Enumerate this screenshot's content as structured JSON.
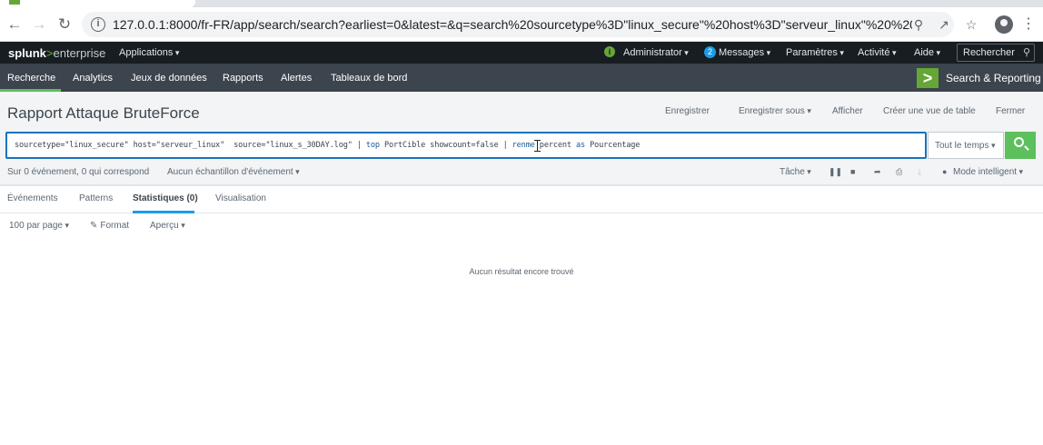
{
  "browser": {
    "url": "127.0.0.1:8000/fr-FR/app/search/search?earliest=0&latest=&q=search%20sourcetype%3D\"linux_secure\"%20host%3D\"serveur_linux\"%20%20source%3D\"li..."
  },
  "splunk_bar": {
    "logo_bold": "splunk",
    "logo_gt": ">",
    "logo_product": "enterprise",
    "apps_label": "Applications",
    "health_icon": "i",
    "admin_label": "Administrator",
    "messages_count": "2",
    "messages_label": "Messages",
    "settings_label": "Paramètres",
    "activity_label": "Activité",
    "help_label": "Aide",
    "search_placeholder": "Rechercher"
  },
  "app_nav": {
    "items": [
      "Recherche",
      "Analytics",
      "Jeux de données",
      "Rapports",
      "Alertes",
      "Tableaux de bord"
    ],
    "app_name": "Search & Reporting"
  },
  "report": {
    "title": "Rapport Attaque BruteForce",
    "actions": [
      "Enregistrer",
      "Enregistrer sous",
      "Afficher",
      "Créer une vue de table",
      "Fermer"
    ]
  },
  "search": {
    "q_part1": "sourcetype=\"linux_secure\" host=\"serveur_linux\"  source=\"linux_s_30DAY.log\" | ",
    "q_cmd1": "top",
    "q_part2": " PortCible showcount=false | ",
    "q_cmd2": "ren",
    "q_part3": "me",
    "q_part4": " percent ",
    "q_as": "as",
    "q_part5": " Pourcentage",
    "time_range": "Tout le temps"
  },
  "status": {
    "events_text": "Sur 0 événement, 0 qui correspond",
    "sampling_label": "Aucun échantillon d'événement",
    "job_label": "Tâche",
    "mode_label": "Mode intelligent"
  },
  "tabs": [
    "Événements",
    "Patterns",
    "Statistiques (0)",
    "Visualisation"
  ],
  "results_toolbar": {
    "per_page": "100 par page",
    "format": "Format",
    "preview": "Aperçu"
  },
  "empty_message": "Aucun résultat encore trouvé",
  "colors": {
    "accent_green": "#5cc05c",
    "splunk_dark": "#171d21",
    "app_bar": "#3c444d",
    "focus_blue": "#1a72bd"
  }
}
